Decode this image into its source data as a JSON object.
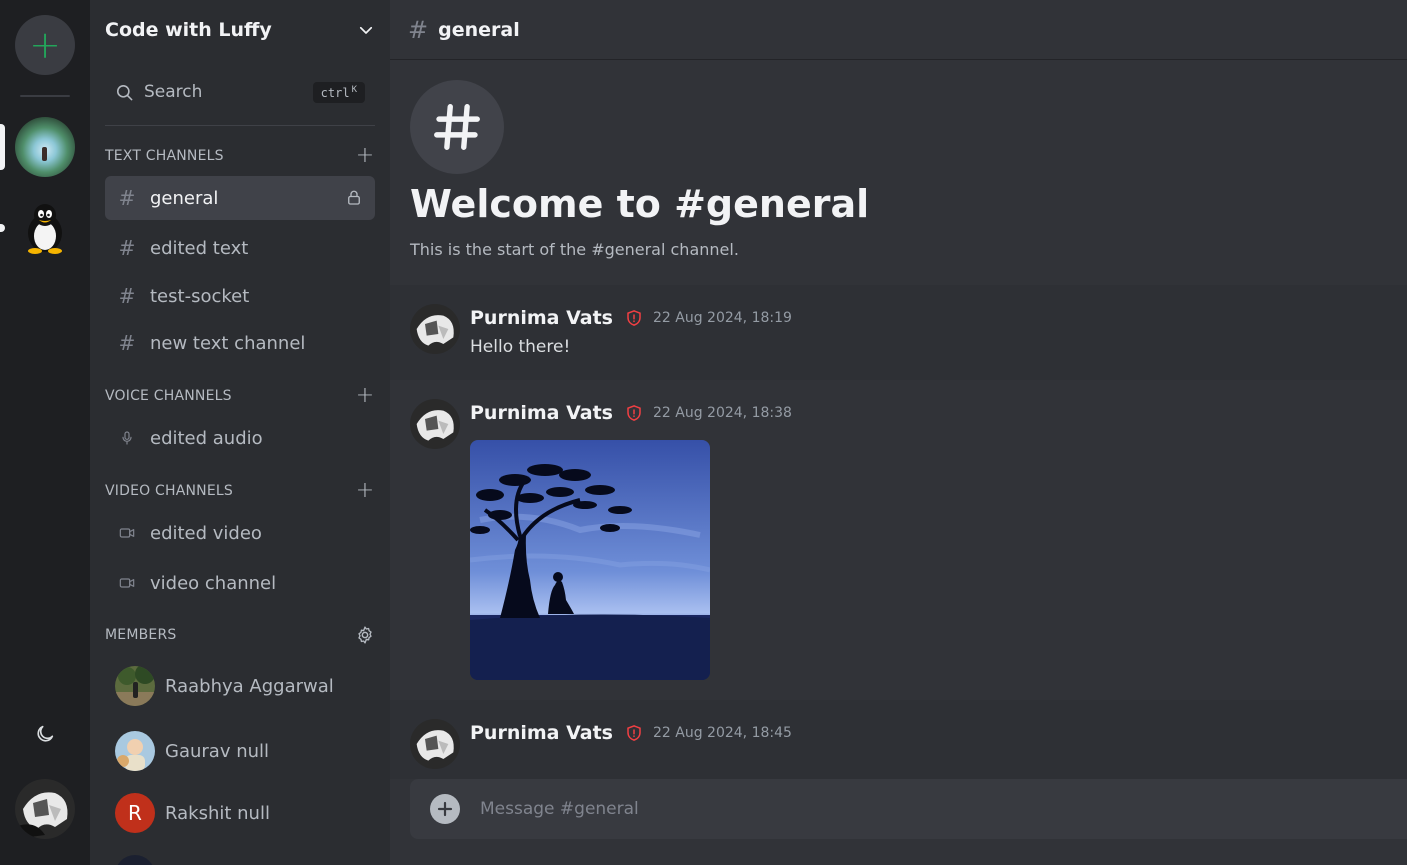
{
  "rail": {
    "add_server_symbol": "+",
    "servers": [
      {
        "name": "server-tree",
        "active": true
      },
      {
        "name": "server-penguin",
        "active": false
      }
    ]
  },
  "sidebar": {
    "server_name": "Code with Luffy",
    "search": {
      "label": "Search",
      "shortcut_key": "ctrl",
      "shortcut_letter": "K"
    },
    "sections": {
      "text": {
        "title": "TEXT CHANNELS"
      },
      "voice": {
        "title": "VOICE CHANNELS"
      },
      "video": {
        "title": "VIDEO CHANNELS"
      },
      "members": {
        "title": "MEMBERS"
      }
    },
    "text_channels": [
      "general",
      "edited text",
      "test-socket",
      "new text channel"
    ],
    "voice_channels": [
      "edited audio"
    ],
    "video_channels": [
      "edited video",
      "video channel"
    ],
    "members": [
      {
        "name": "Raabhya Aggarwal"
      },
      {
        "name": "Gaurav null"
      },
      {
        "name": "Rakshit null",
        "initial": "R"
      }
    ]
  },
  "main": {
    "channel_title": "general",
    "welcome_title": "Welcome to #general",
    "welcome_subtitle": "This is the start of the #general channel.",
    "messages": [
      {
        "author": "Purnima Vats",
        "time": "22 Aug 2024, 18:19",
        "text": "Hello there!"
      },
      {
        "author": "Purnima Vats",
        "time": "22 Aug 2024, 18:38",
        "text": ""
      },
      {
        "author": "Purnima Vats",
        "time": "22 Aug 2024, 18:45",
        "text": ""
      }
    ],
    "composer_placeholder": "Message #general"
  },
  "colors": {
    "accent_green": "#23a55a",
    "role_red": "#f23f43",
    "background": "#313338"
  }
}
